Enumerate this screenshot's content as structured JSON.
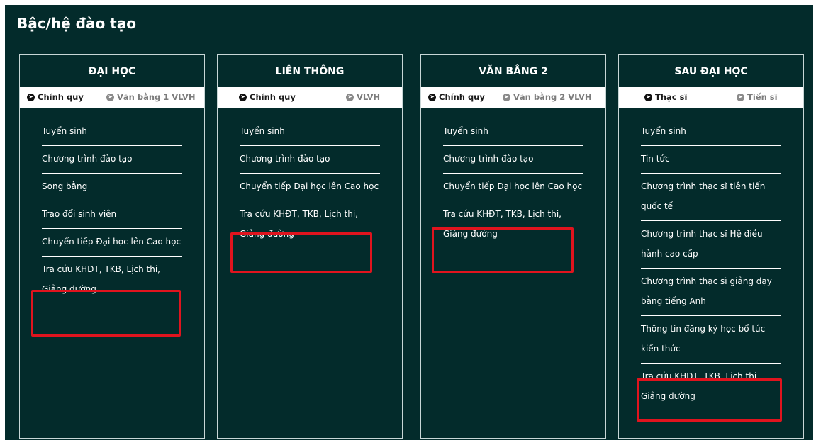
{
  "page": {
    "title": "Bậc/hệ đào tạo"
  },
  "columns": [
    {
      "heading": "ĐẠI HỌC",
      "tabs": [
        {
          "label": "Chính quy",
          "active": true
        },
        {
          "label": "Văn bằng 1 VLVH",
          "active": false
        }
      ],
      "items": [
        "Tuyển sinh",
        "Chương trình đào tạo",
        "Song bằng",
        "Trao đổi sinh viên",
        "Chuyển tiếp Đại học lên Cao học",
        "Tra cứu KHĐT, TKB, Lịch thi, Giảng đường"
      ]
    },
    {
      "heading": "LIÊN THÔNG",
      "tabs": [
        {
          "label": "Chính quy",
          "active": true
        },
        {
          "label": "VLVH",
          "active": false
        }
      ],
      "items": [
        "Tuyển sinh",
        "Chương trình đào tạo",
        "Chuyển tiếp Đại học lên Cao học",
        "Tra cứu KHĐT, TKB, Lịch thi, Giảng đường"
      ]
    },
    {
      "heading": "VĂN BẰNG 2",
      "tabs": [
        {
          "label": "Chính quy",
          "active": true
        },
        {
          "label": "Văn bằng 2 VLVH",
          "active": false
        }
      ],
      "items": [
        "Tuyển sinh",
        "Chương trình đào tạo",
        "Chuyển tiếp Đại học lên Cao học",
        "Tra cứu KHĐT, TKB, Lịch thi, Giảng đường"
      ]
    },
    {
      "heading": "SAU ĐẠI HỌC",
      "tabs": [
        {
          "label": "Thạc sĩ",
          "active": true
        },
        {
          "label": "Tiến sĩ",
          "active": false
        }
      ],
      "items": [
        "Tuyển sinh",
        "Tin tức",
        "Chương trình thạc sĩ tiên tiến quốc tế",
        "Chương trình thạc sĩ Hệ điều hành cao cấp",
        "Chương trình thạc sĩ giảng dạy bằng tiếng Anh",
        "Thông tin đăng ký học bổ túc kiến thức",
        "Tra cứu KHĐT, TKB, Lịch thi, Giảng đường"
      ]
    }
  ],
  "icons": {
    "tab_arrow": "arrow-circle-right-icon"
  },
  "colors": {
    "panel_bg": "#032b2b",
    "highlight": "#e0141e",
    "text": "#ffffff"
  }
}
